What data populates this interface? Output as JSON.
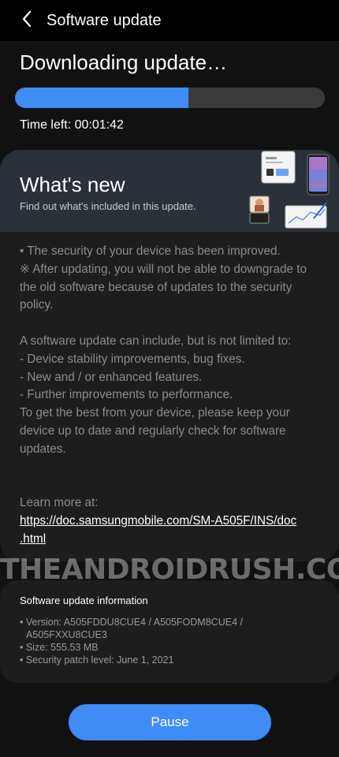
{
  "appbar": {
    "title": "Software update",
    "back_icon": "chevron-left-icon"
  },
  "download": {
    "heading": "Downloading update…",
    "progress_fraction": 0.56,
    "time_left": "Time left: 00:01:42"
  },
  "whats_new": {
    "title": "What's new",
    "subtitle": "Find out what's included in this update.",
    "notes": [
      "• The security of your device has been improved.",
      "※ After updating, you will not be able to downgrade to",
      "the old software because of updates to the security",
      "policy."
    ],
    "notes2": [
      "A software update can include, but is not limited to:",
      " - Device stability improvements, bug fixes.",
      " - New and / or enhanced features.",
      " - Further improvements to performance.",
      "To get the best from your device, please keep your",
      "device up to date and regularly check for software",
      "updates."
    ],
    "learn_more": "Learn more at:",
    "link_line1": "https://doc.samsungmobile.com/SM-A505F/INS/doc",
    "link_line2": ".html"
  },
  "info": {
    "title": "Software update information",
    "lines": [
      "• Version: A505FDDU8CUE4 / A505FODM8CUE4 /",
      "  A505FXXU8CUE3",
      "• Size: 555.53 MB",
      "• Security patch level: June 1, 2021"
    ]
  },
  "watermark": "THEANDROIDRUSH.COM",
  "pause_button": "Pause",
  "colors": {
    "accent": "#3f8cf6",
    "background": "#000000",
    "card": "#1d1d1d",
    "hero": "#2b3138"
  }
}
